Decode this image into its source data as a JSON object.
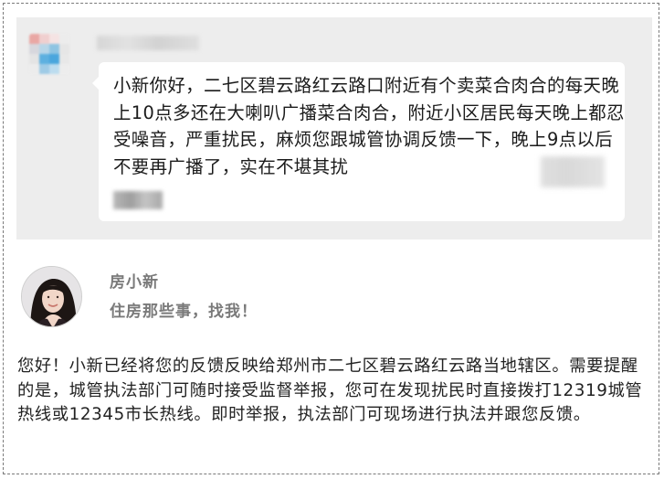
{
  "chat": {
    "message": "小新你好，二七区碧云路红云路口附近有个卖菜合肉合的每天晚上10点多还在大喇叭广播菜合肉合，附近小区居民每天晚上都忍受噪音，严重扰民，麻烦您跟城管协调反馈一下，晚上9点以后不要再广播了，实在不堪其扰"
  },
  "profile": {
    "name": "房小新",
    "slogan": "住房那些事，找我！"
  },
  "reply": {
    "text": "您好！小新已经将您的反馈反映给郑州市二七区碧云路红云路当地辖区。需要提醒的是，城管执法部门可随时接受监督举报，您可在发现扰民时直接拨打12319城管热线或12345市长热线。即时举报，执法部门可现场进行执法并跟您反馈。"
  },
  "colors": {
    "chat_background": "#ededed",
    "bubble": "#ffffff",
    "profile_text": "#7a7a7a",
    "body_text": "#222222",
    "frame_border": "#7a7a7a"
  },
  "icons": {
    "sender_avatar": "pixelated-avatar-icon",
    "profile_photo": "woman-portrait-avatar"
  }
}
